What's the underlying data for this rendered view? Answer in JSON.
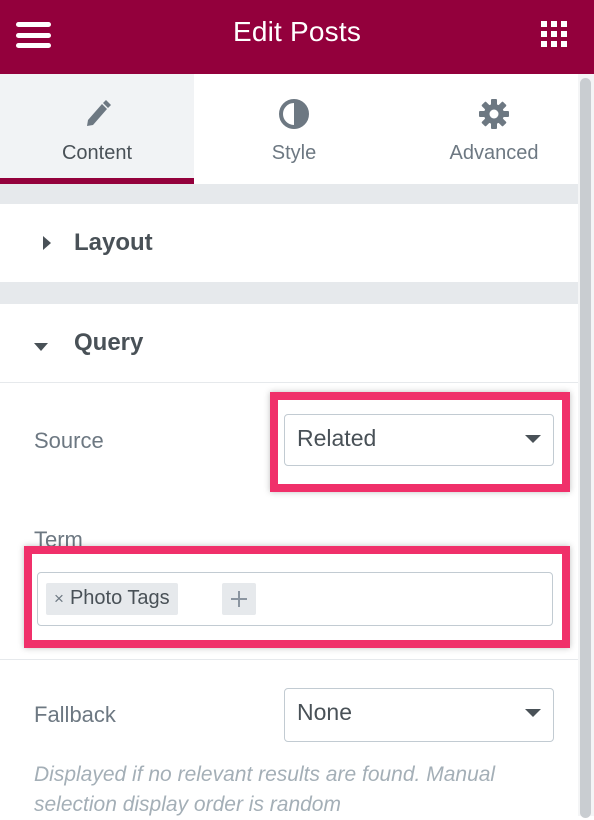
{
  "header": {
    "title": "Edit Posts"
  },
  "tabs": [
    {
      "label": "Content",
      "icon": "pencil-icon",
      "active": true
    },
    {
      "label": "Style",
      "icon": "half-circle-icon",
      "active": false
    },
    {
      "label": "Advanced",
      "icon": "gear-icon",
      "active": false
    }
  ],
  "sections": {
    "layout": {
      "label": "Layout",
      "expanded": false
    },
    "query": {
      "label": "Query",
      "expanded": true
    }
  },
  "fields": {
    "source": {
      "label": "Source",
      "value": "Related"
    },
    "term": {
      "label": "Term",
      "tags": [
        "Photo Tags"
      ]
    },
    "fallback": {
      "label": "Fallback",
      "value": "None",
      "description": "Displayed if no relevant results are found. Manual selection display order is random"
    }
  },
  "colors": {
    "brand": "#93003c",
    "highlight": "#f0306a"
  }
}
